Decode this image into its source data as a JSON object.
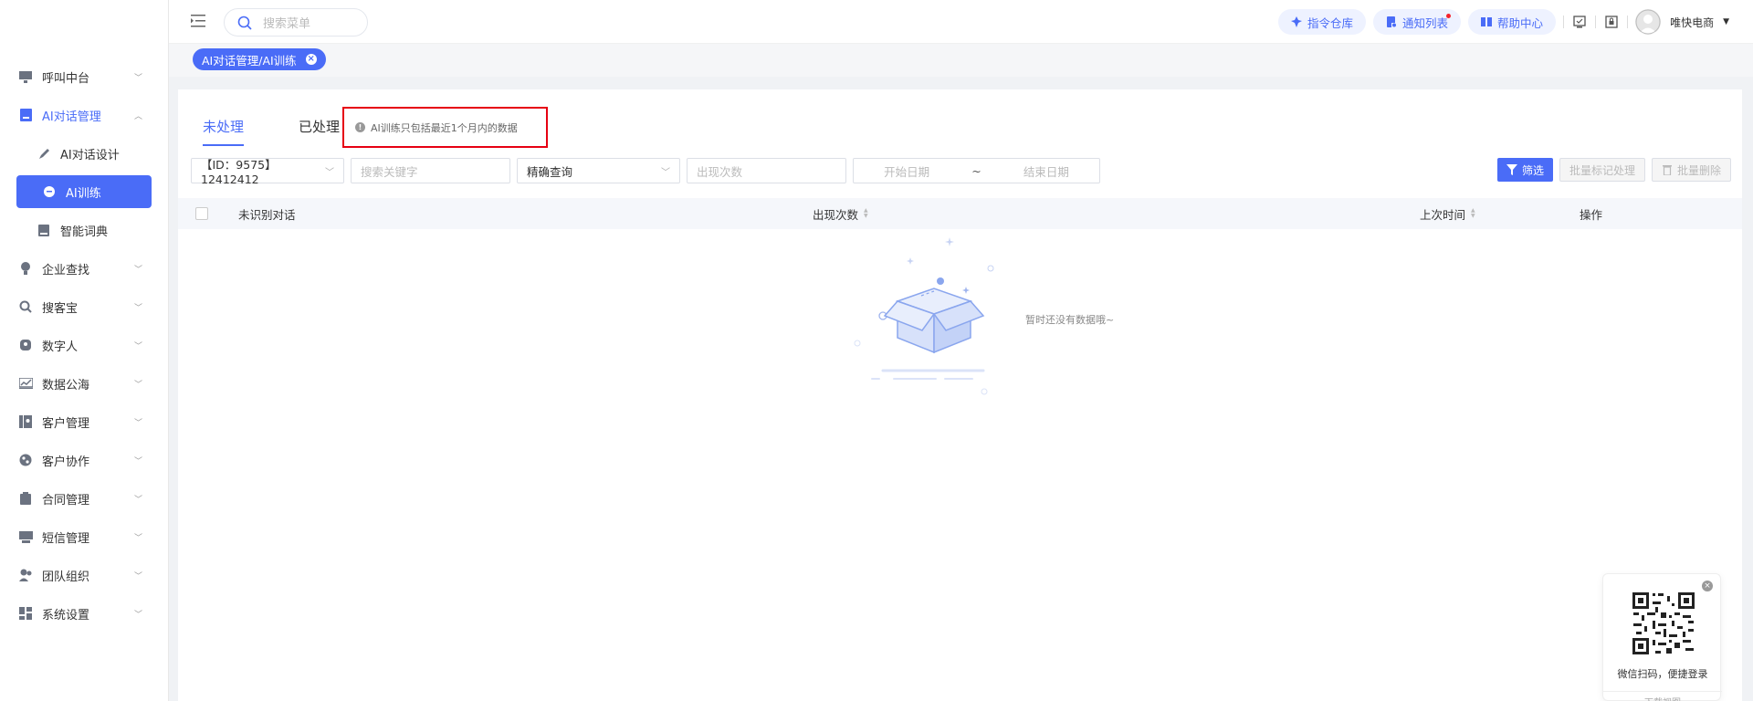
{
  "header": {
    "search_placeholder": "搜索菜单",
    "pills": [
      {
        "label": "指令仓库",
        "icon": "pin-icon"
      },
      {
        "label": "通知列表",
        "icon": "bell-doc-icon",
        "dot": true
      },
      {
        "label": "帮助中心",
        "icon": "book-icon"
      }
    ],
    "user_name": "唯快电商"
  },
  "sidebar": {
    "items": [
      {
        "label": "呼叫中台",
        "icon": "monitor-icon"
      },
      {
        "label": "AI对话管理",
        "icon": "robot-icon",
        "expanded": true
      },
      {
        "label": "AI对话设计",
        "icon": "edit-icon"
      },
      {
        "label": "AI训练",
        "icon": "chat-bubble-icon"
      },
      {
        "label": "智能词典",
        "icon": "dictionary-icon"
      },
      {
        "label": "企业查找",
        "icon": "lightbulb-icon"
      },
      {
        "label": "搜客宝",
        "icon": "magnifier-icon"
      },
      {
        "label": "数字人",
        "icon": "digital-human-icon"
      },
      {
        "label": "数据公海",
        "icon": "chart-icon"
      },
      {
        "label": "客户管理",
        "icon": "contact-book-icon"
      },
      {
        "label": "客户协作",
        "icon": "collaboration-icon"
      },
      {
        "label": "合同管理",
        "icon": "clipboard-icon"
      },
      {
        "label": "短信管理",
        "icon": "message-icon"
      },
      {
        "label": "团队组织",
        "icon": "team-icon"
      },
      {
        "label": "系统设置",
        "icon": "grid-icon"
      }
    ]
  },
  "tags": {
    "current": "AI对话管理/AI训练"
  },
  "tabs": {
    "pending": "未处理",
    "processed": "已处理"
  },
  "notice": "AI训练只包括最近1个月内的数据",
  "filters": {
    "id_select": "【ID：9575】12412412",
    "keyword_placeholder": "搜索关键字",
    "match_select": "精确查询",
    "count_placeholder": "出现次数",
    "start_placeholder": "开始日期",
    "range_sep": "~",
    "end_placeholder": "结束日期"
  },
  "actions": {
    "filter": "筛选",
    "batch_mark": "批量标记处理",
    "batch_delete": "批量删除"
  },
  "table": {
    "columns": [
      "未识别对话",
      "出现次数",
      "上次时间",
      "操作"
    ],
    "empty_text": "暂时还没有数据哦~"
  },
  "qr": {
    "text": "微信扫码，便捷登录",
    "sub": "下载视图"
  },
  "colors": {
    "accent": "#4a6cf7",
    "highlight_border": "#e60012"
  }
}
